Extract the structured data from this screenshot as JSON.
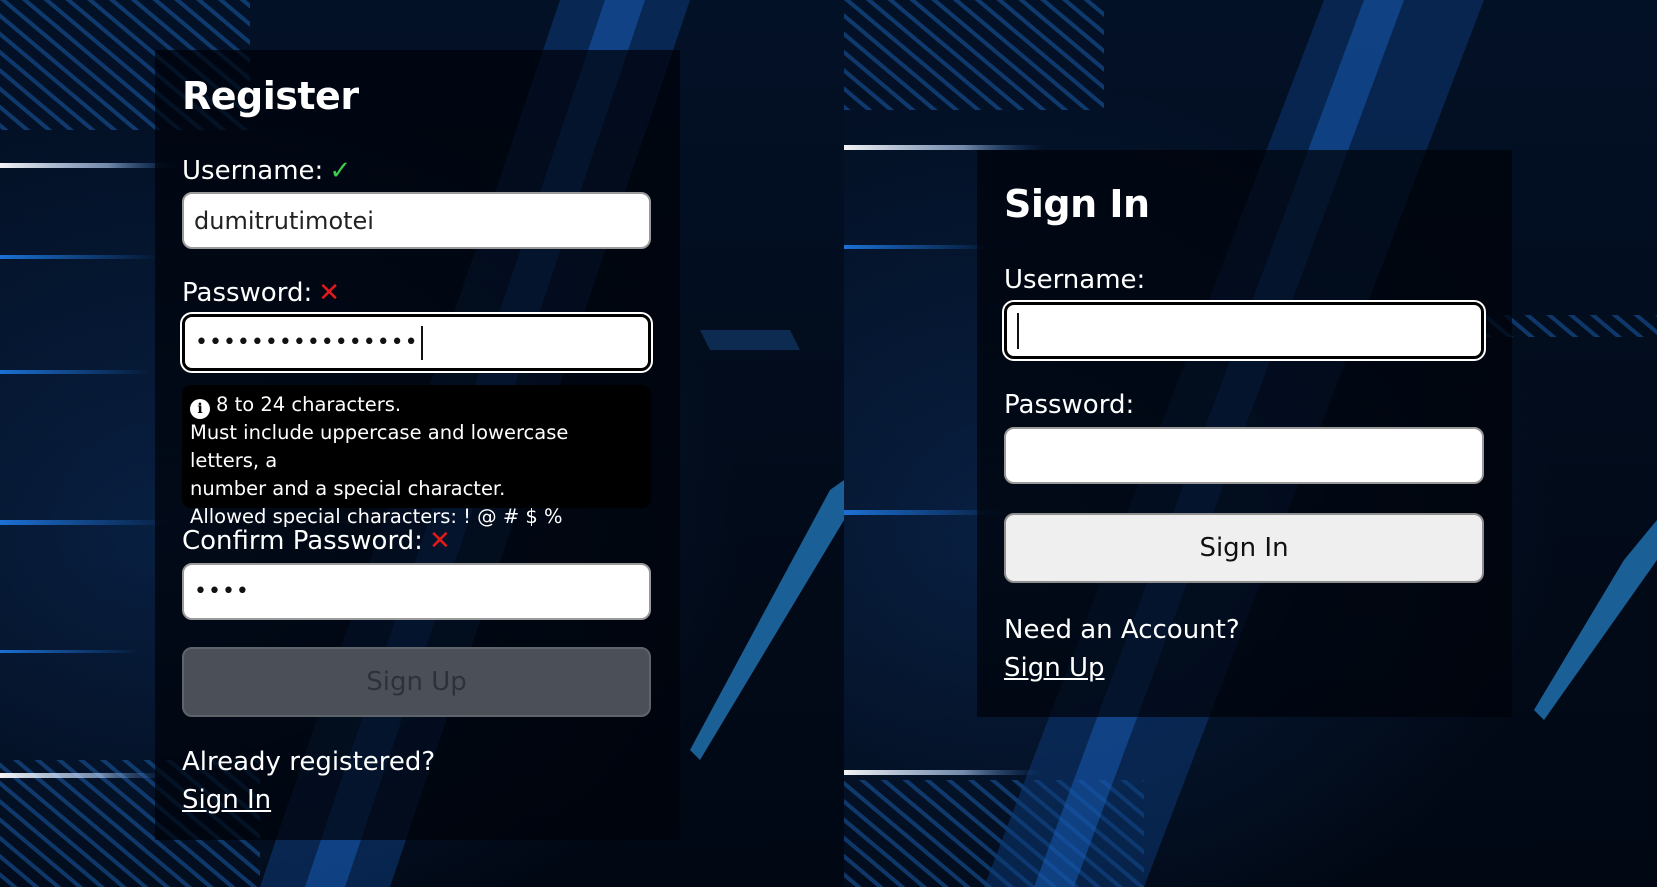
{
  "register": {
    "title": "Register",
    "username_label": "Username:",
    "username_status": "valid",
    "username_value": "dumitrutimotei",
    "password_label": "Password:",
    "password_status": "invalid",
    "password_masked": "••••••••••••••••",
    "hint": {
      "icon": "info-icon",
      "line1": "8 to 24 characters.",
      "line2": "Must include uppercase and lowercase letters, a",
      "line3": "number and a special character.",
      "line4": "Allowed special characters: ! @ # $ %"
    },
    "confirm_label": "Confirm Password:",
    "confirm_status": "invalid",
    "confirm_masked": "••••",
    "signup_button": "Sign Up",
    "signup_button_state": "disabled",
    "already_text": "Already registered?",
    "signin_link": "Sign In"
  },
  "signin": {
    "title": "Sign In",
    "username_label": "Username:",
    "username_value": "",
    "password_label": "Password:",
    "password_value": "",
    "signin_button": "Sign In",
    "need_account_text": "Need an Account?",
    "signup_link": "Sign Up"
  },
  "icons": {
    "valid": "check-icon",
    "invalid": "x-icon"
  },
  "colors": {
    "valid": "#3ecc4e",
    "invalid": "#e21a1a",
    "background": "#031127",
    "disabled_button": "#4b5058"
  }
}
